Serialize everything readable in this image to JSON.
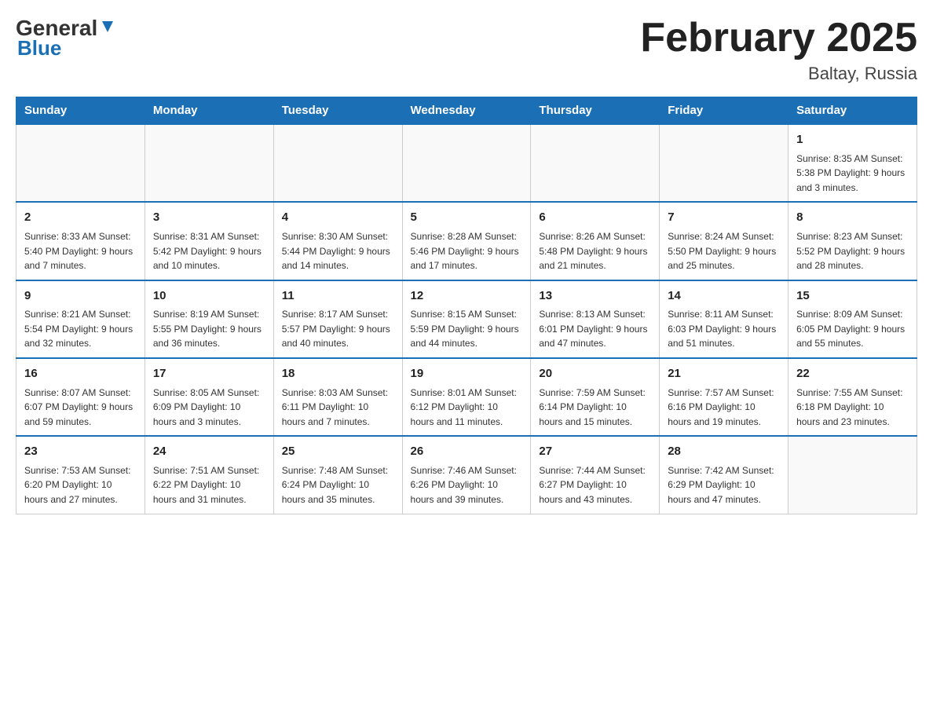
{
  "header": {
    "logo_general": "General",
    "logo_blue": "Blue",
    "title": "February 2025",
    "subtitle": "Baltay, Russia"
  },
  "weekdays": [
    "Sunday",
    "Monday",
    "Tuesday",
    "Wednesday",
    "Thursday",
    "Friday",
    "Saturday"
  ],
  "weeks": [
    [
      {
        "day": "",
        "info": ""
      },
      {
        "day": "",
        "info": ""
      },
      {
        "day": "",
        "info": ""
      },
      {
        "day": "",
        "info": ""
      },
      {
        "day": "",
        "info": ""
      },
      {
        "day": "",
        "info": ""
      },
      {
        "day": "1",
        "info": "Sunrise: 8:35 AM\nSunset: 5:38 PM\nDaylight: 9 hours and 3 minutes."
      }
    ],
    [
      {
        "day": "2",
        "info": "Sunrise: 8:33 AM\nSunset: 5:40 PM\nDaylight: 9 hours and 7 minutes."
      },
      {
        "day": "3",
        "info": "Sunrise: 8:31 AM\nSunset: 5:42 PM\nDaylight: 9 hours and 10 minutes."
      },
      {
        "day": "4",
        "info": "Sunrise: 8:30 AM\nSunset: 5:44 PM\nDaylight: 9 hours and 14 minutes."
      },
      {
        "day": "5",
        "info": "Sunrise: 8:28 AM\nSunset: 5:46 PM\nDaylight: 9 hours and 17 minutes."
      },
      {
        "day": "6",
        "info": "Sunrise: 8:26 AM\nSunset: 5:48 PM\nDaylight: 9 hours and 21 minutes."
      },
      {
        "day": "7",
        "info": "Sunrise: 8:24 AM\nSunset: 5:50 PM\nDaylight: 9 hours and 25 minutes."
      },
      {
        "day": "8",
        "info": "Sunrise: 8:23 AM\nSunset: 5:52 PM\nDaylight: 9 hours and 28 minutes."
      }
    ],
    [
      {
        "day": "9",
        "info": "Sunrise: 8:21 AM\nSunset: 5:54 PM\nDaylight: 9 hours and 32 minutes."
      },
      {
        "day": "10",
        "info": "Sunrise: 8:19 AM\nSunset: 5:55 PM\nDaylight: 9 hours and 36 minutes."
      },
      {
        "day": "11",
        "info": "Sunrise: 8:17 AM\nSunset: 5:57 PM\nDaylight: 9 hours and 40 minutes."
      },
      {
        "day": "12",
        "info": "Sunrise: 8:15 AM\nSunset: 5:59 PM\nDaylight: 9 hours and 44 minutes."
      },
      {
        "day": "13",
        "info": "Sunrise: 8:13 AM\nSunset: 6:01 PM\nDaylight: 9 hours and 47 minutes."
      },
      {
        "day": "14",
        "info": "Sunrise: 8:11 AM\nSunset: 6:03 PM\nDaylight: 9 hours and 51 minutes."
      },
      {
        "day": "15",
        "info": "Sunrise: 8:09 AM\nSunset: 6:05 PM\nDaylight: 9 hours and 55 minutes."
      }
    ],
    [
      {
        "day": "16",
        "info": "Sunrise: 8:07 AM\nSunset: 6:07 PM\nDaylight: 9 hours and 59 minutes."
      },
      {
        "day": "17",
        "info": "Sunrise: 8:05 AM\nSunset: 6:09 PM\nDaylight: 10 hours and 3 minutes."
      },
      {
        "day": "18",
        "info": "Sunrise: 8:03 AM\nSunset: 6:11 PM\nDaylight: 10 hours and 7 minutes."
      },
      {
        "day": "19",
        "info": "Sunrise: 8:01 AM\nSunset: 6:12 PM\nDaylight: 10 hours and 11 minutes."
      },
      {
        "day": "20",
        "info": "Sunrise: 7:59 AM\nSunset: 6:14 PM\nDaylight: 10 hours and 15 minutes."
      },
      {
        "day": "21",
        "info": "Sunrise: 7:57 AM\nSunset: 6:16 PM\nDaylight: 10 hours and 19 minutes."
      },
      {
        "day": "22",
        "info": "Sunrise: 7:55 AM\nSunset: 6:18 PM\nDaylight: 10 hours and 23 minutes."
      }
    ],
    [
      {
        "day": "23",
        "info": "Sunrise: 7:53 AM\nSunset: 6:20 PM\nDaylight: 10 hours and 27 minutes."
      },
      {
        "day": "24",
        "info": "Sunrise: 7:51 AM\nSunset: 6:22 PM\nDaylight: 10 hours and 31 minutes."
      },
      {
        "day": "25",
        "info": "Sunrise: 7:48 AM\nSunset: 6:24 PM\nDaylight: 10 hours and 35 minutes."
      },
      {
        "day": "26",
        "info": "Sunrise: 7:46 AM\nSunset: 6:26 PM\nDaylight: 10 hours and 39 minutes."
      },
      {
        "day": "27",
        "info": "Sunrise: 7:44 AM\nSunset: 6:27 PM\nDaylight: 10 hours and 43 minutes."
      },
      {
        "day": "28",
        "info": "Sunrise: 7:42 AM\nSunset: 6:29 PM\nDaylight: 10 hours and 47 minutes."
      },
      {
        "day": "",
        "info": ""
      }
    ]
  ]
}
